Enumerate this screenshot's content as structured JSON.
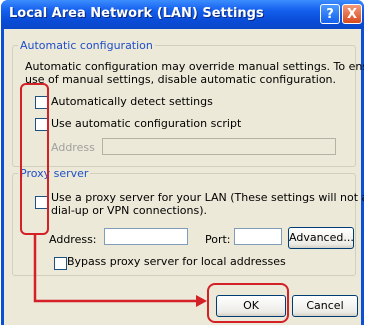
{
  "window": {
    "title": "Local Area Network (LAN) Settings",
    "help_glyph": "?",
    "close_glyph": "X"
  },
  "auto_config": {
    "legend": "Automatic configuration",
    "description": [
      "Automatic configuration may override manual settings.  To ensure the",
      "use of manual settings, disable automatic configuration."
    ],
    "detect_label": "Automatically detect settings",
    "detect_checked": false,
    "script_label": "Use automatic configuration script",
    "script_checked": false,
    "address_label": "Address",
    "address_value": ""
  },
  "proxy": {
    "legend": "Proxy server",
    "use_proxy_label": [
      "Use a proxy server for your LAN (These settings will not apply to",
      "dial-up or VPN connections)."
    ],
    "use_proxy_checked": false,
    "address_label": "Address:",
    "address_value": "",
    "port_label": "Port:",
    "port_value": "",
    "advanced_label": "Advanced...",
    "bypass_label": "Bypass proxy server for local addresses",
    "bypass_checked": false
  },
  "buttons": {
    "ok_label": "OK",
    "cancel_label": "Cancel"
  },
  "annotation": {
    "color": "#d42027"
  }
}
